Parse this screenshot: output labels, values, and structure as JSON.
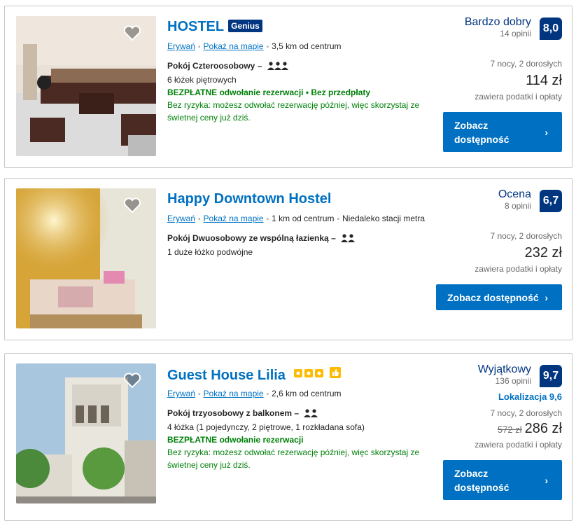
{
  "cards": [
    {
      "name": "HOSTEL",
      "badge": "Genius",
      "area": "Erywań",
      "map_link": "Pokaż na mapie",
      "distance": "3,5 km od centrum",
      "extra": "",
      "room_type": "Pokój Czteroosobowy",
      "room_persons": 3,
      "beds": "6 łóżek piętrowych",
      "cancellation": "BEZPŁATNE odwołanie rezerwacji • Bez przedpłaty",
      "no_risk": "Bez ryzyka: możesz odwołać rezerwację później, więc skorzystaj ze świetnej ceny już dziś.",
      "rating_word": "Bardzo dobry",
      "reviews": "14 opinii",
      "score": "8,0",
      "location_score": "",
      "nights": "7 nocy, 2 dorosłych",
      "old_price": "",
      "price": "114 zł",
      "taxes": "zawiera podatki i opłaty",
      "button": "Zobacz dostępność"
    },
    {
      "name": "Happy Downtown Hostel",
      "badge": "",
      "area": "Erywań",
      "map_link": "Pokaż na mapie",
      "distance": "1 km od centrum",
      "extra": "Niedaleko stacji metra",
      "room_type": "Pokój Dwuosobowy ze wspólną łazienką",
      "room_persons": 2,
      "beds": "1 duże łóżko podwójne",
      "cancellation": "",
      "no_risk": "",
      "rating_word": "Ocena",
      "reviews": "8 opinii",
      "score": "6,7",
      "location_score": "",
      "nights": "7 nocy, 2 dorosłych",
      "old_price": "",
      "price": "232 zł",
      "taxes": "zawiera podatki i opłaty",
      "button": "Zobacz dostępność"
    },
    {
      "name": "Guest House Lilia",
      "badge": "",
      "area": "Erywań",
      "map_link": "Pokaż na mapie",
      "distance": "2,6 km od centrum",
      "extra": "",
      "room_type": "Pokój trzyosobowy z balkonem",
      "room_persons": 2,
      "beds": "4 łóżka (1 pojedynczy, 2 piętrowe, 1 rozkładana sofa)",
      "cancellation": "BEZPŁATNE odwołanie rezerwacji",
      "no_risk": "Bez ryzyka: możesz odwołać rezerwację później, więc skorzystaj ze świetnej ceny już dziś.",
      "rating_word": "Wyjątkowy",
      "reviews": "136 opinii",
      "score": "9,7",
      "location_score": "Lokalizacja 9,6",
      "nights": "7 nocy, 2 dorosłych",
      "old_price": "572 zł",
      "price": "286 zł",
      "taxes": "zawiera podatki i opłaty",
      "button": "Zobacz dostępność"
    }
  ],
  "icons": {
    "favorite": "heart-icon",
    "person": "person-icon",
    "chevron": "chevron-right-icon",
    "star_rating": "square-star-icon",
    "thumbs_up": "thumbs-up-icon"
  },
  "colors": {
    "brand_blue": "#003580",
    "link_blue": "#0071c2",
    "green": "#008009",
    "star_yellow": "#febb02"
  },
  "property_stars": 3
}
